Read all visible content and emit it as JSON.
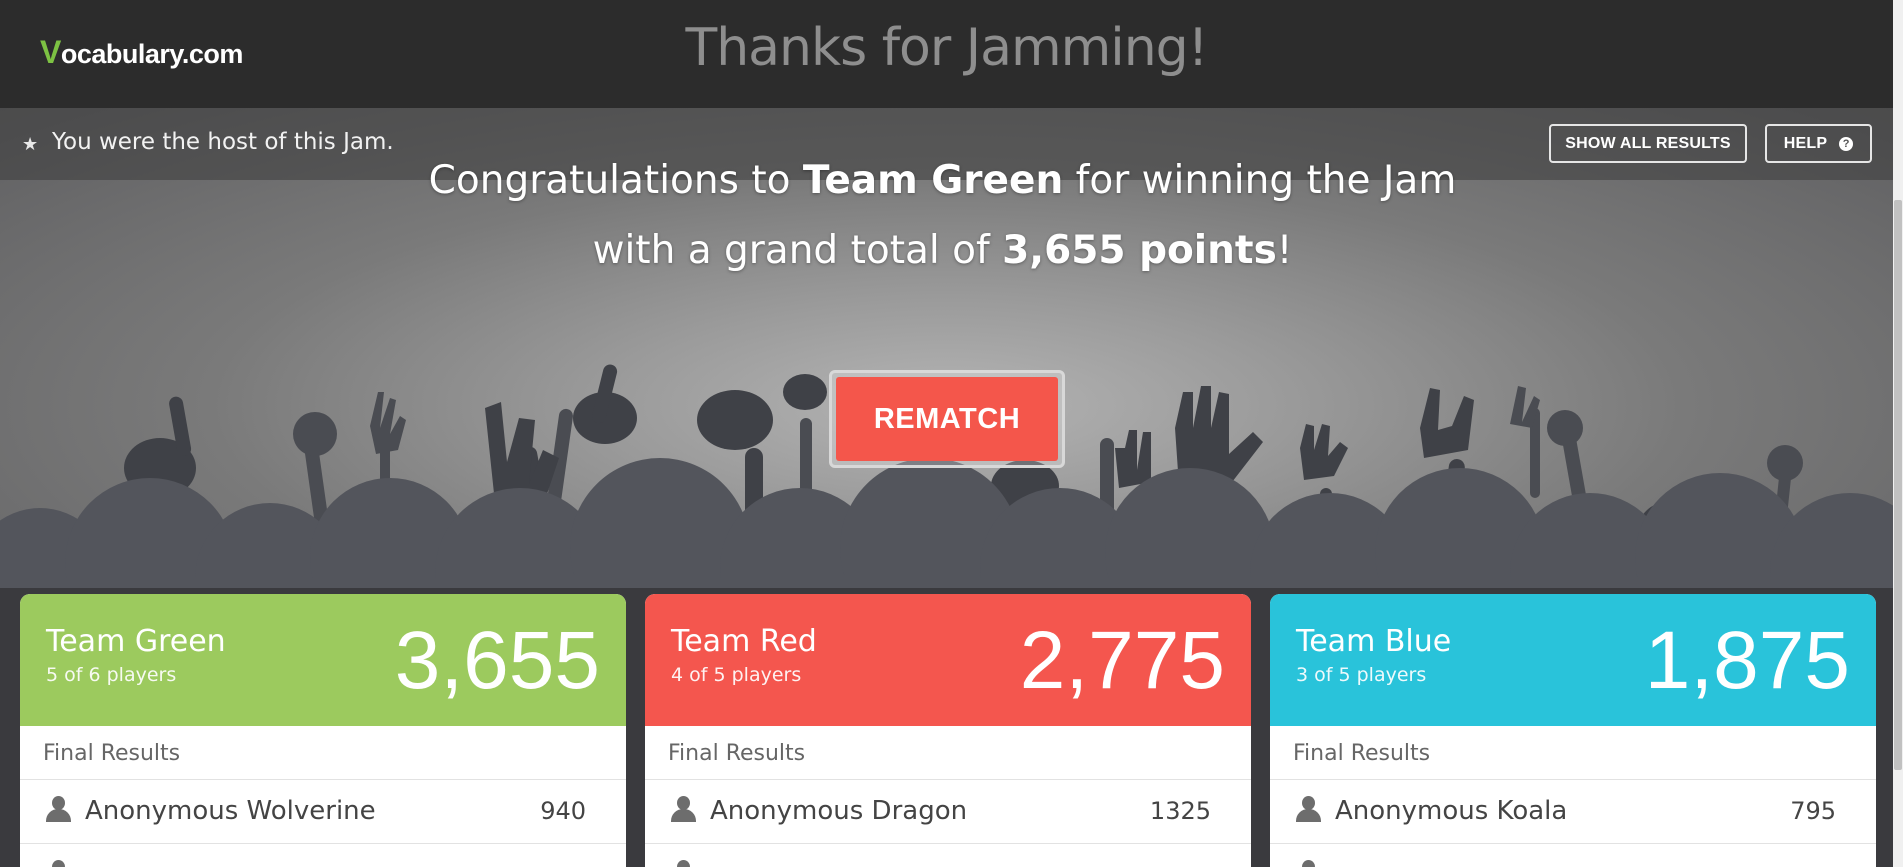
{
  "brand": {
    "logo_v": "V",
    "logo_rest": "ocabulary.com"
  },
  "page_title": "Thanks for Jamming!",
  "host": {
    "text": "You were the host of this Jam."
  },
  "buttons": {
    "show_all": "SHOW ALL RESULTS",
    "help": "HELP",
    "help_icon": "?",
    "rematch": "REMATCH"
  },
  "congrats": {
    "line1_pre": "Congratulations to ",
    "winner": "Team Green",
    "line1_post": " for winning the Jam",
    "line2_pre": "with a grand total of ",
    "points": "3,655 points",
    "line2_post": "!"
  },
  "teams": [
    {
      "name": "Team Green",
      "players": "5 of 6 players",
      "score": "3,655",
      "color": "#9cca5e",
      "results_label": "Final Results",
      "top_player": {
        "name": "Anonymous Wolverine",
        "score": "940"
      }
    },
    {
      "name": "Team Red",
      "players": "4 of 5 players",
      "score": "2,775",
      "color": "#f4564e",
      "results_label": "Final Results",
      "top_player": {
        "name": "Anonymous Dragon",
        "score": "1325"
      }
    },
    {
      "name": "Team Blue",
      "players": "3 of 5 players",
      "score": "1,875",
      "color": "#29c3da",
      "results_label": "Final Results",
      "top_player": {
        "name": "Anonymous Koala",
        "score": "795"
      }
    }
  ]
}
